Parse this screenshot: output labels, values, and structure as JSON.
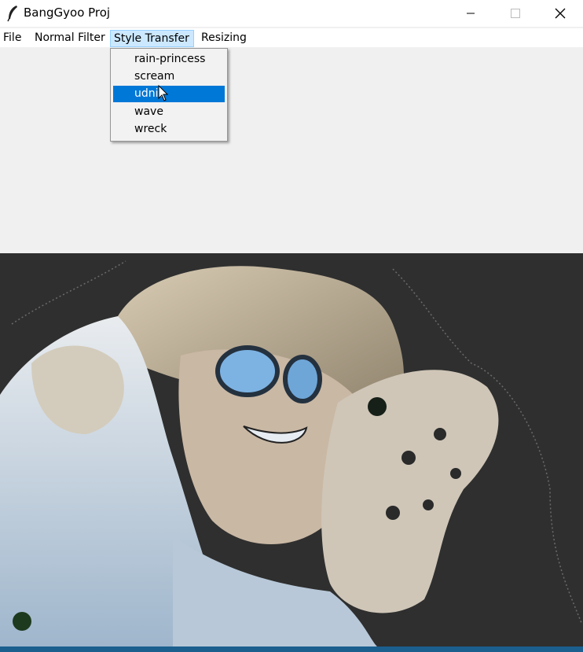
{
  "window": {
    "title": "BangGyoo Proj",
    "controls": [
      "minimize-icon",
      "maximize-icon",
      "close-icon"
    ]
  },
  "menubar": {
    "items": [
      {
        "label": "File"
      },
      {
        "label": "Normal Filter"
      },
      {
        "label": "Style Transfer",
        "active": true
      },
      {
        "label": "Resizing"
      }
    ]
  },
  "style_transfer_menu": {
    "items": [
      {
        "label": "rain-princess"
      },
      {
        "label": "scream"
      },
      {
        "label": "udnie",
        "highlighted": true
      },
      {
        "label": "wave"
      },
      {
        "label": "wreck"
      }
    ]
  },
  "image": {
    "description_icon": "stylized-portrait-image"
  },
  "colors": {
    "highlight": "#0078d7",
    "menu_active_bg": "#cce8ff",
    "canvas_bg": "#2d2d2d",
    "taskbar": "#1a5f8e"
  }
}
